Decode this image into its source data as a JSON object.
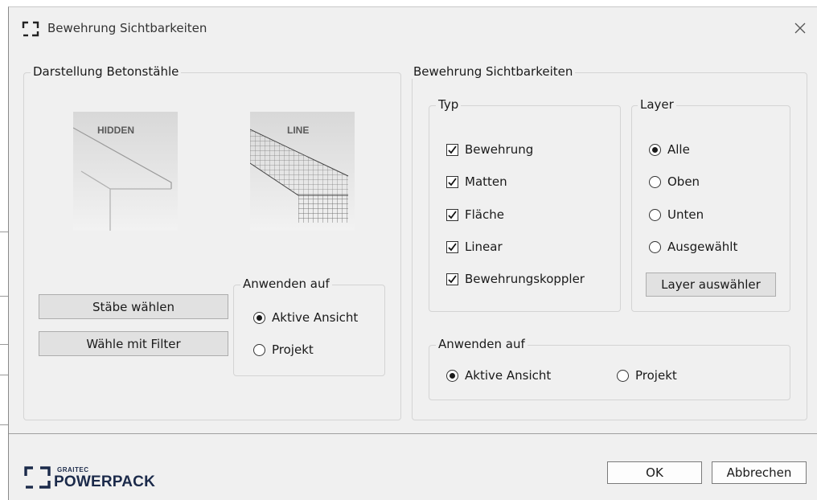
{
  "window": {
    "title": "Bewehrung Sichtbarkeiten",
    "close_icon": "close-icon"
  },
  "darstellung": {
    "legend": "Darstellung Betonstähle",
    "preview_hidden": "HIDDEN",
    "preview_line": "LINE",
    "btn_staebe": "Stäbe wählen",
    "btn_filter": "Wähle mit Filter",
    "anwenden": {
      "legend": "Anwenden auf",
      "option_aktiv": "Aktive Ansicht",
      "option_projekt": "Projekt",
      "selected": "Aktive Ansicht"
    }
  },
  "sichtbarkeiten": {
    "legend": "Bewehrung Sichtbarkeiten",
    "typ": {
      "legend": "Typ",
      "items": [
        {
          "label": "Bewehrung",
          "checked": true
        },
        {
          "label": "Matten",
          "checked": true
        },
        {
          "label": "Fläche",
          "checked": true
        },
        {
          "label": "Linear",
          "checked": true
        },
        {
          "label": "Bewehrungskoppler",
          "checked": true
        }
      ]
    },
    "layer": {
      "legend": "Layer",
      "options": [
        "Alle",
        "Oben",
        "Unten",
        "Ausgewählt"
      ],
      "selected": "Alle",
      "btn": "Layer auswähler"
    },
    "anwenden": {
      "legend": "Anwenden auf",
      "option_aktiv": "Aktive Ansicht",
      "option_projekt": "Projekt",
      "selected": "Aktive Ansicht"
    }
  },
  "footer": {
    "logo_small": "GRAITEC",
    "logo_big": "POWERPACK",
    "ok": "OK",
    "cancel": "Abbrechen"
  }
}
